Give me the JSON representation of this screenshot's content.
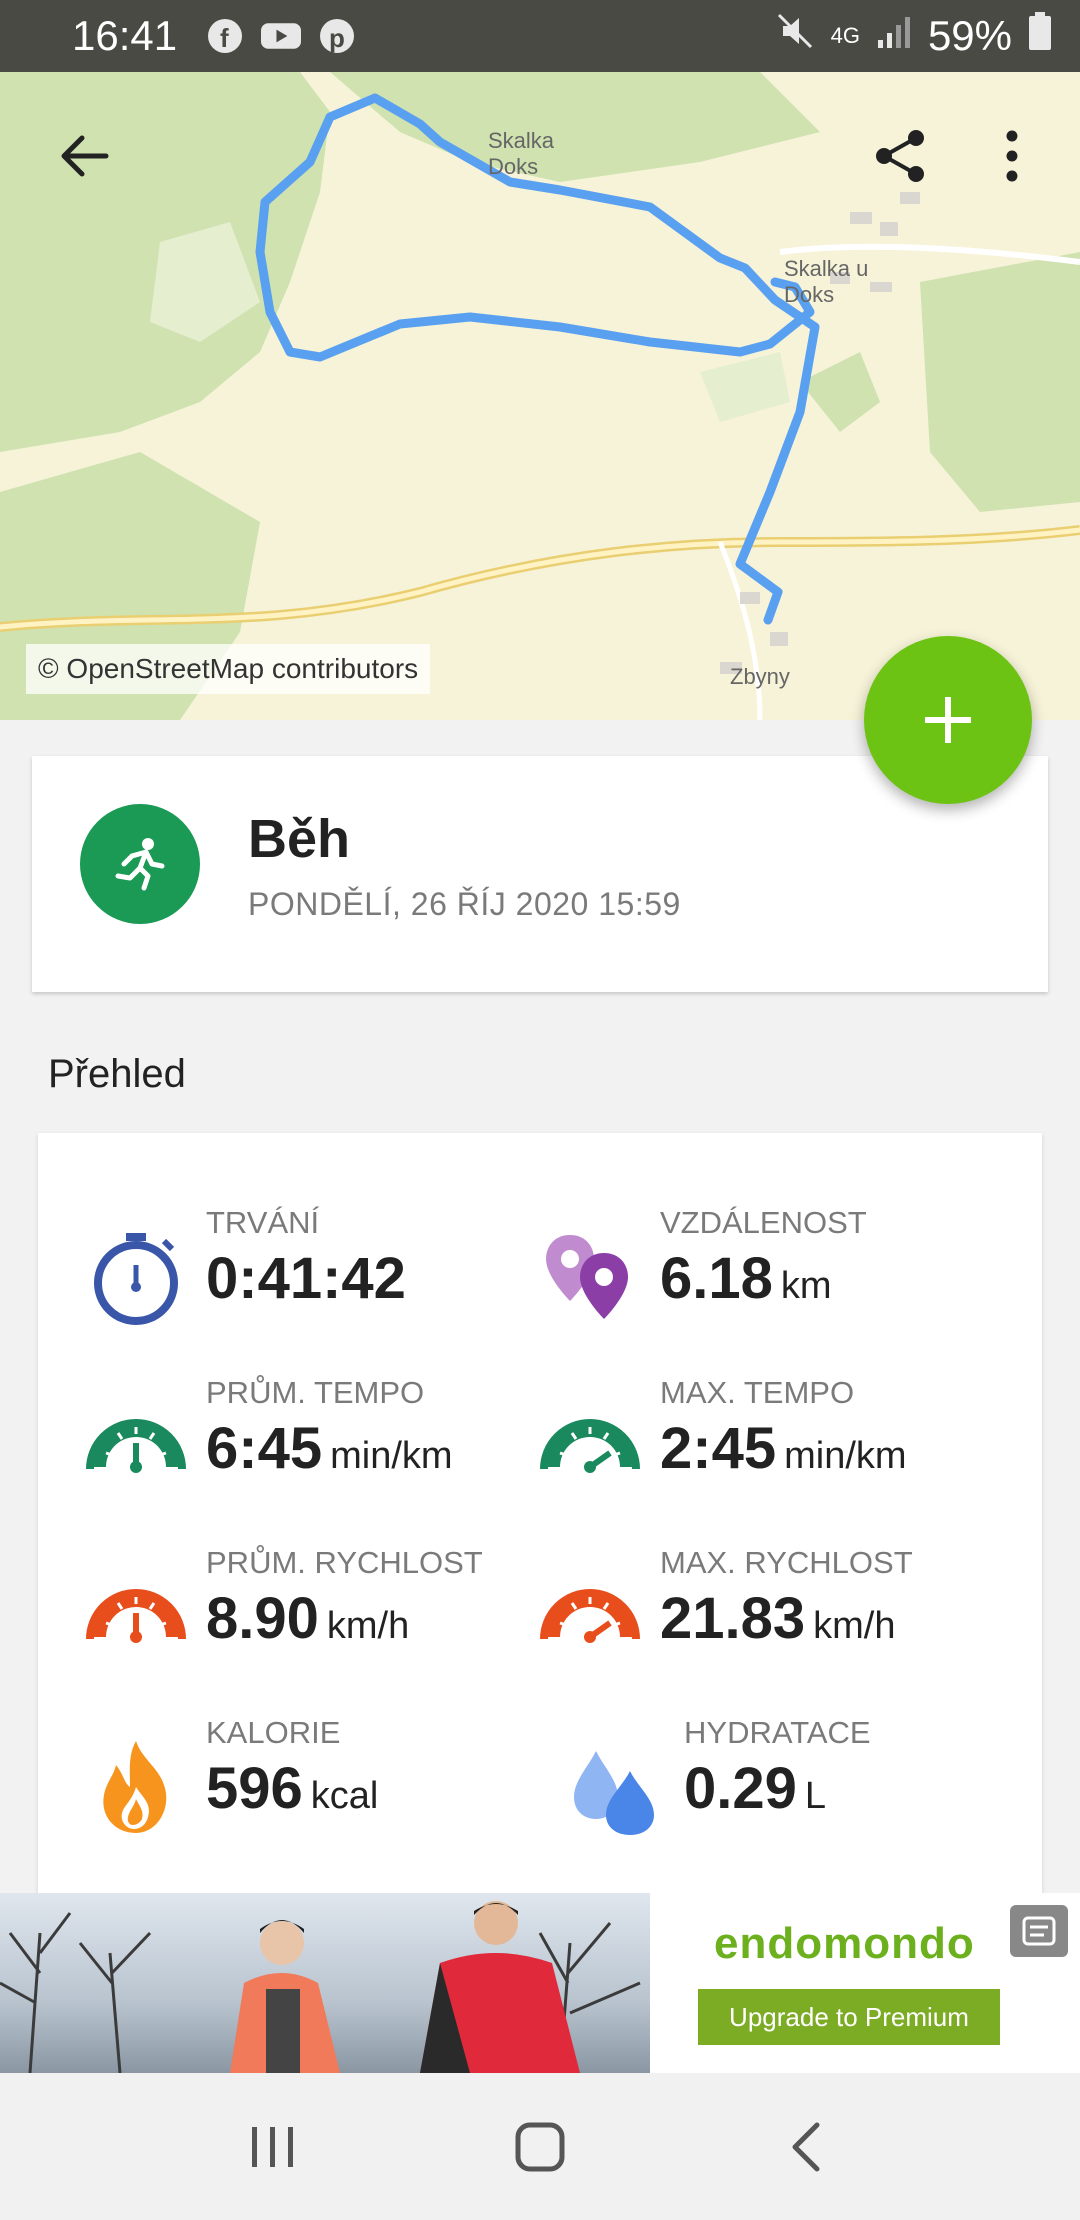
{
  "status_bar": {
    "time": "16:41",
    "network": "4G",
    "battery": "59%",
    "left_icons": [
      "facebook-icon",
      "youtube-icon",
      "pinterest-icon"
    ],
    "right_icons": [
      "mute-icon",
      "signal-icon",
      "battery-icon"
    ]
  },
  "map": {
    "attribution": "© OpenStreetMap contributors",
    "places": {
      "skalka_doks": "Skalka\nDoks",
      "skalka_u_doks": "Skalka u\nDoks",
      "zbyny": "Zbyny"
    },
    "route_color": "#5aa0f0"
  },
  "toolbar": {
    "back_icon": "arrow-left-icon",
    "share_icon": "share-icon",
    "more_icon": "more-vertical-icon"
  },
  "fab": {
    "icon": "plus-icon",
    "color": "#6cc314"
  },
  "activity": {
    "title": "Běh",
    "date": "PONDĚLÍ, 26 ŘÍJ 2020 15:59",
    "icon": "running-icon",
    "icon_color": "#1a9a55"
  },
  "overview": {
    "title": "Přehled",
    "stats": [
      {
        "label": "TRVÁNÍ",
        "value": "0:41:42",
        "unit": "",
        "icon": "stopwatch-icon"
      },
      {
        "label": "VZDÁLENOST",
        "value": "6.18",
        "unit": "km",
        "icon": "location-pins-icon"
      },
      {
        "label": "PRŮM. TEMPO",
        "value": "6:45",
        "unit": "min/km",
        "icon": "speedometer-green-icon"
      },
      {
        "label": "MAX. TEMPO",
        "value": "2:45",
        "unit": "min/km",
        "icon": "speedometer-green-max-icon"
      },
      {
        "label": "PRŮM. RYCHLOST",
        "value": "8.90",
        "unit": "km/h",
        "icon": "speedometer-red-icon"
      },
      {
        "label": "MAX. RYCHLOST",
        "value": "21.83",
        "unit": "km/h",
        "icon": "speedometer-red-max-icon"
      },
      {
        "label": "KALORIE",
        "value": "596",
        "unit": "kcal",
        "icon": "flame-icon"
      },
      {
        "label": "HYDRATACE",
        "value": "0.29",
        "unit": "L",
        "icon": "water-drops-icon"
      }
    ]
  },
  "ad": {
    "logo": "endomondo",
    "cta": "Upgrade to Premium"
  },
  "nav_bar": {
    "items": [
      "recents-icon",
      "home-icon",
      "back-icon"
    ]
  }
}
